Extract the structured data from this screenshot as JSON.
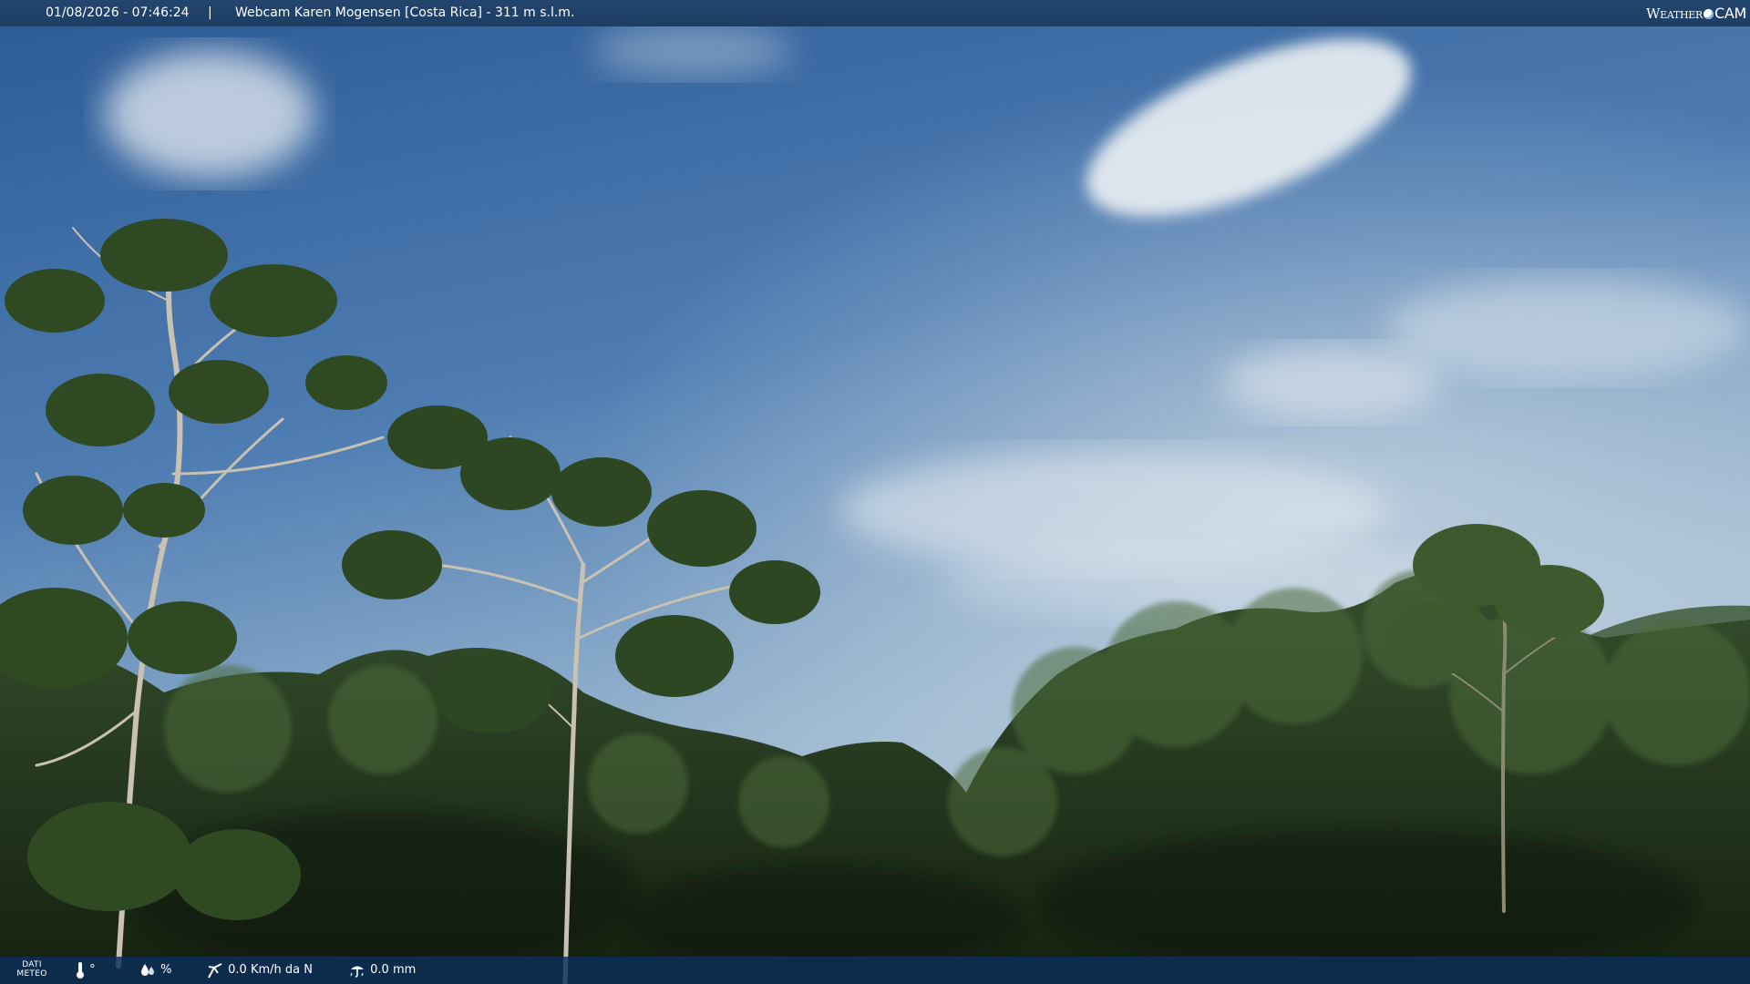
{
  "header": {
    "datetime": "01/08/2026 - 07:46:24",
    "separator": "|",
    "title": "Webcam Karen Mogensen [Costa Rica]  - 311 m s.l.m."
  },
  "brand": {
    "weather": "Weather",
    "cam": "CAM"
  },
  "weather_bar": {
    "label_line1": "DATI",
    "label_line2": "METEO",
    "temperature": "°",
    "humidity": "%",
    "wind": "0.0 Km/h da N",
    "rain": "0.0 mm",
    "icons": [
      "thermometer-icon",
      "humidity-icon",
      "wind-icon",
      "rain-icon"
    ]
  },
  "colors": {
    "sky_top": "#2f5e9a",
    "sky_horizon": "#a9c3d6",
    "foliage": "#263d22",
    "bar": "#1d3d63"
  }
}
